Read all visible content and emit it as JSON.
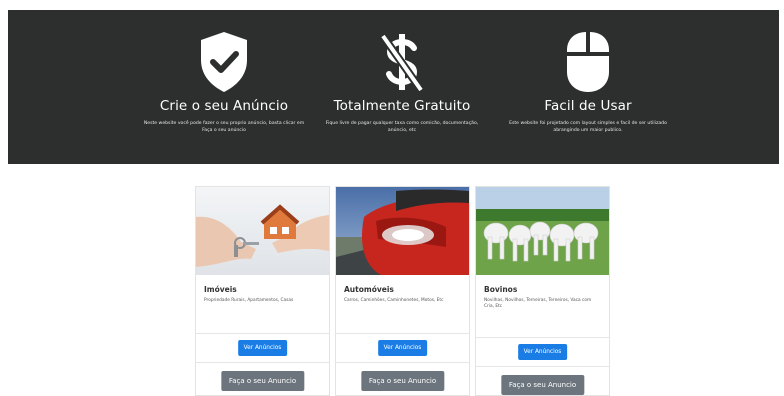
{
  "features": [
    {
      "icon": "shield-check-icon",
      "title": "Crie o seu Anúncio",
      "text": "Neste website você pode fazer o seu proprio anúncio, basta clicar em Faça o seu anúncio"
    },
    {
      "icon": "dollar-crossed-icon",
      "title": "Totalmente Gratuito",
      "text": "Fique livre de pagar qualquer taxa como comicão, documentação, anúncio, etc"
    },
    {
      "icon": "mouse-icon",
      "title": "Facil de Usar",
      "text": "Este website foi projetado com layout simples e facil de ser utilizado abrangindo um maior publico."
    }
  ],
  "cards": [
    {
      "title": "Imóveis",
      "description": "Propriedade Rurais, Apartamentos, Casas",
      "primary_button": "Ver Anúncios",
      "secondary_button": "Faça o seu Anuncio"
    },
    {
      "title": "Automóveis",
      "description": "Carros, Caminhões, Caminhonetes, Motos, Etc",
      "primary_button": "Ver Anúncios",
      "secondary_button": "Faça o seu Anuncio"
    },
    {
      "title": "Bovinos",
      "description": "Novilhas, Novilhos, Terneiras, Terneiros, Vaca com Cria, Etc",
      "primary_button": "Ver Anúncios",
      "secondary_button": "Faça o seu Anuncio"
    }
  ]
}
